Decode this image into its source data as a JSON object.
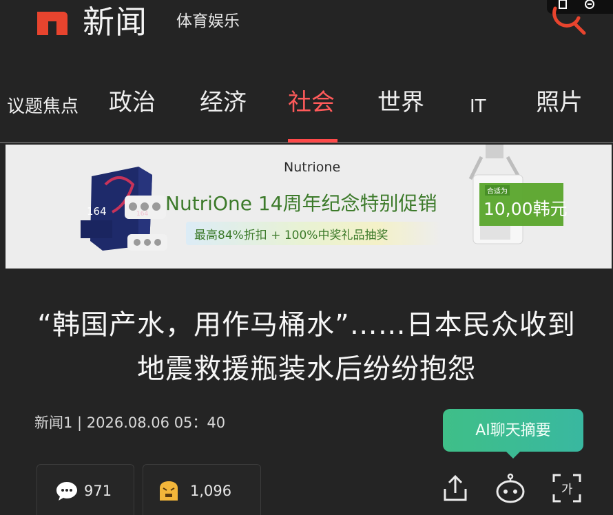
{
  "header": {
    "logo_letter": "n",
    "app_title": "新闻",
    "sub_title": "体育娱乐",
    "brand_color": "#e8442e"
  },
  "nav": {
    "items": [
      {
        "label": "议题焦点"
      },
      {
        "label": "政治"
      },
      {
        "label": "经济"
      },
      {
        "label": "社会",
        "active": true
      },
      {
        "label": "世界"
      },
      {
        "label": "IT"
      },
      {
        "label": "照片"
      }
    ],
    "active_color": "#ff5a5a"
  },
  "ad": {
    "brand": "Nutrione",
    "headline": "NutriOne 14周年纪念特别促销",
    "sub": "最高84%折扣 + 100%中奖礼品抽奖",
    "box_number": "164",
    "box_number_small": "164",
    "price_tag": "合适为",
    "price": "10,00韩元",
    "accent_color": "#3c7a2a"
  },
  "article": {
    "headline": "“韩国产水，用作马桶水”……日本民众收到地震救援瓶装水后纷纷抱怨",
    "meta": "新闻1 | 2026.08.06 05：40"
  },
  "ai_summary": {
    "label": "AI聊天摘要",
    "color": "#3fbf88"
  },
  "actions": {
    "comment_count": "971",
    "reaction_count": "1,096",
    "icons": [
      "comment-icon",
      "angry-reaction-icon",
      "share-icon",
      "ai-bot-icon",
      "font-size-icon"
    ]
  }
}
